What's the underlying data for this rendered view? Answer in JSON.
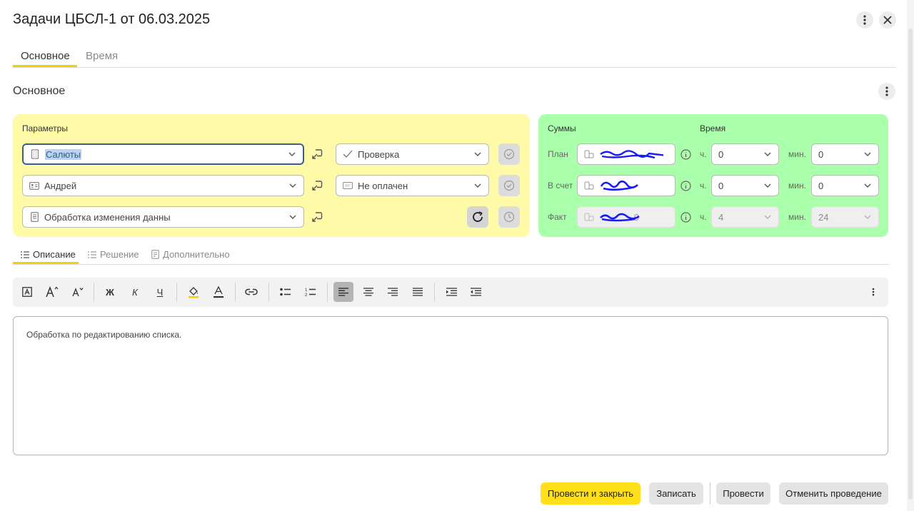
{
  "window": {
    "title": "Задачи ЦБСЛ-1 от 06.03.2025"
  },
  "tabs": [
    {
      "label": "Основное"
    },
    {
      "label": "Время"
    }
  ],
  "section": {
    "title": "Основное"
  },
  "params": {
    "label": "Параметры",
    "fields": [
      {
        "value": "Салюты",
        "icon": "building-icon"
      },
      {
        "value": "Андрей",
        "icon": "contact-card-icon"
      },
      {
        "value": "Обработка изменения данны",
        "icon": "document-icon"
      }
    ],
    "status": [
      {
        "value": "Проверка",
        "icon": "check-icon"
      },
      {
        "value": "Не оплачен",
        "icon": "visa-card-icon"
      }
    ]
  },
  "sums": {
    "label": "Суммы",
    "rows": [
      {
        "label": "План"
      },
      {
        "label": "В счет"
      },
      {
        "label": "Факт",
        "value": "0"
      }
    ]
  },
  "time": {
    "label": "Время",
    "hours_label": "ч.",
    "minutes_label": "мин.",
    "rows": [
      {
        "hours": "0",
        "minutes": "0"
      },
      {
        "hours": "0",
        "minutes": "0"
      },
      {
        "hours": "4",
        "minutes": "24"
      }
    ]
  },
  "subtabs": [
    {
      "label": "Описание"
    },
    {
      "label": "Решение"
    },
    {
      "label": "Дополнительно"
    }
  ],
  "toolbar": {
    "bold": "Ж",
    "italic": "К",
    "underline": "Ч"
  },
  "editor": {
    "text": "Обработка по редактированию списка."
  },
  "buttons": {
    "post_close": "Провести и закрыть",
    "save": "Записать",
    "post": "Провести",
    "unpost": "Отменить проведение"
  },
  "colors": {
    "accent": "#f5d000",
    "primary_button": "#ffe01a",
    "params_panel": "#fffaa8",
    "sums_panel": "#aaffaa",
    "scribble": "#1a1aff"
  }
}
